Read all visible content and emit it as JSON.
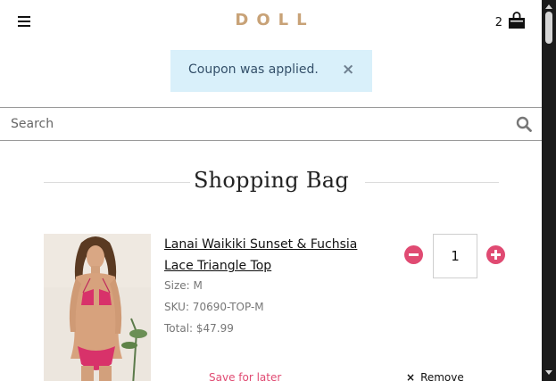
{
  "header": {
    "logo": "DOLL",
    "cart_count": "2",
    "menu_icon": "hamburger-menu-icon",
    "cart_icon": "shopping-bag-icon"
  },
  "alert": {
    "message": "Coupon was applied.",
    "close_glyph": "×"
  },
  "search": {
    "placeholder": "Search",
    "value": "",
    "icon": "search-icon"
  },
  "page": {
    "heading": "Shopping Bag"
  },
  "cart_items": [
    {
      "name_line1": "Lanai Waikiki Sunset & Fuchsia",
      "name_line2": "Lace Triangle Top",
      "size": "Size: M",
      "sku": "SKU: 70690-TOP-M",
      "total": "Total: $47.99",
      "quantity": "1",
      "save_label": "Save for later",
      "remove_label": "Remove",
      "remove_glyph": "×"
    }
  ],
  "colors": {
    "brand": "#c8a277",
    "accent": "#e04a72",
    "alert_bg": "#d9f0fa"
  }
}
